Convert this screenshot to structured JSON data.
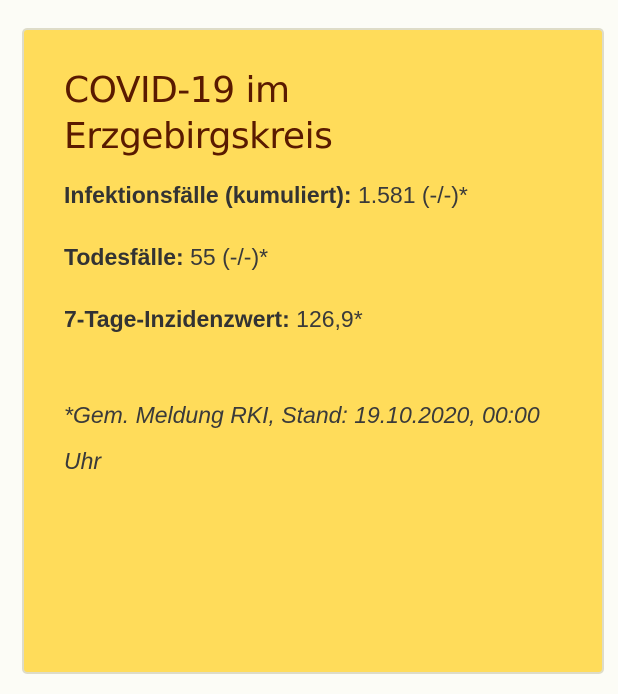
{
  "card": {
    "title": "COVID-19 im Erzgebirgskreis",
    "stats": [
      {
        "label": "Infektionsfälle (kumuliert):",
        "value": "1.581 (-/-)*"
      },
      {
        "label": "Todesfälle:",
        "value": "55 (-/-)*"
      },
      {
        "label": "7-Tage-Inzidenzwert:",
        "value": "126,9*"
      }
    ],
    "footnote": "*Gem. Meldung RKI, Stand: 19.10.2020, 00:00 Uhr"
  },
  "colors": {
    "card_background": "#ffdc5a",
    "title": "#5a1a00",
    "text": "#3a3a3a",
    "page_background": "#fcfcf6"
  }
}
